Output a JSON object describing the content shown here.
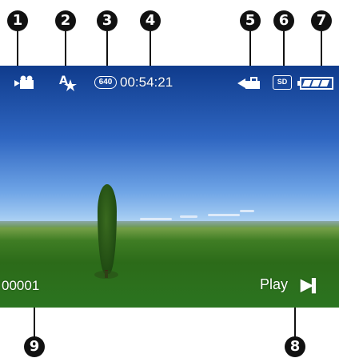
{
  "callouts": [
    "1",
    "2",
    "3",
    "4",
    "5",
    "6",
    "7",
    "8",
    "9"
  ],
  "status_bar": {
    "mode_icon": "movie-camera-icon",
    "flash_icon": "auto-flash-icon",
    "resolution_badge": "640",
    "elapsed_time": "00:54:21",
    "protect_icon": "lock-icon",
    "storage_badge": "SD",
    "battery_icon": "battery-icon"
  },
  "bottom_bar": {
    "frame_number": "00001",
    "play_label": "Play",
    "play_pause_symbol": "▶||"
  },
  "colors": {
    "sky_top": "#0f3b8c",
    "grass": "#2b7420",
    "osd_text": "#ffffff",
    "callout_fill": "#111111"
  }
}
